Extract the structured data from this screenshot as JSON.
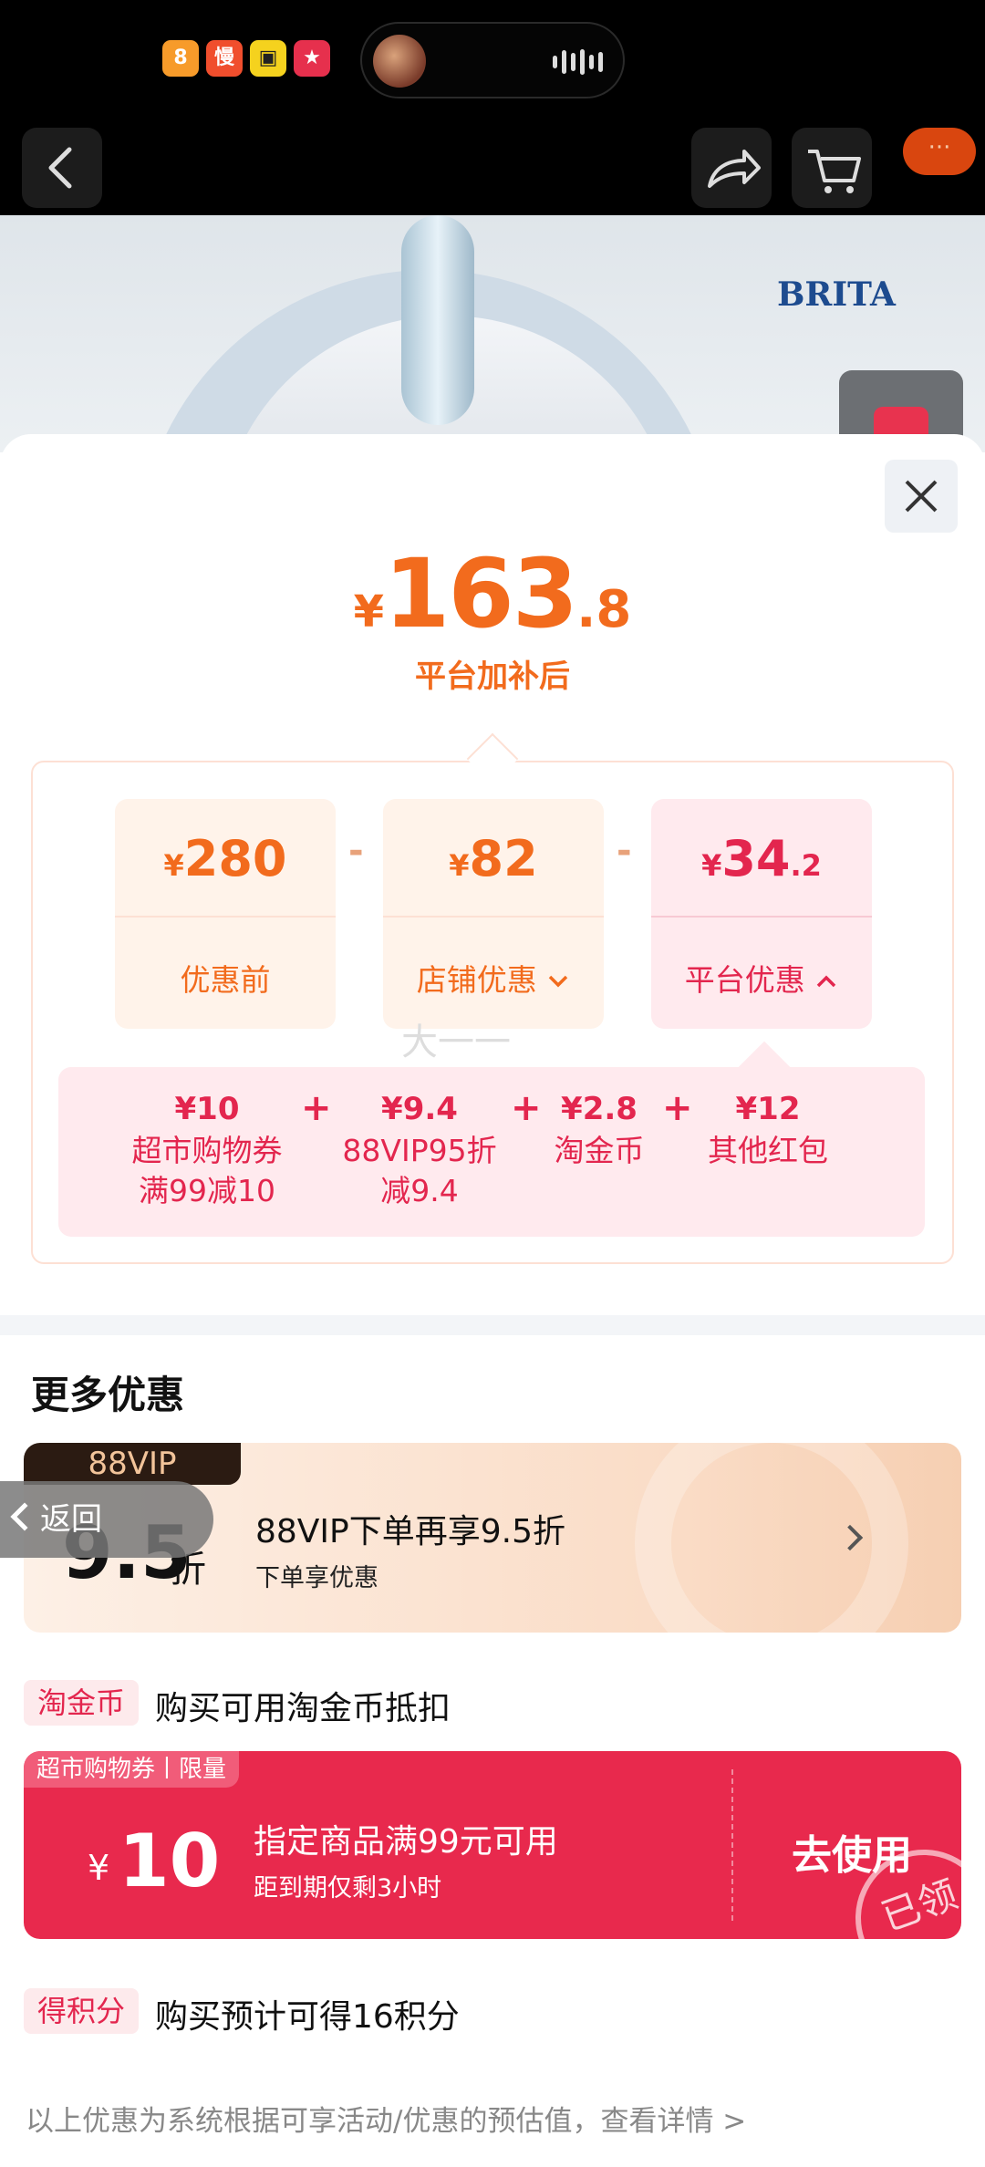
{
  "status_bar": {
    "app_icons": [
      {
        "label": "8",
        "color": "#f79b2a"
      },
      {
        "label": "慢",
        "color": "#f04e2d"
      },
      {
        "label": "▣",
        "color": "#f5d21e"
      },
      {
        "label": "★",
        "color": "#e6304d"
      }
    ]
  },
  "nav": {
    "back_icon": "chevron-left-icon",
    "share_icon": "share-icon",
    "cart_icon": "cart-icon",
    "more_badge": "···"
  },
  "product": {
    "brand": "BRITA"
  },
  "sheet": {
    "close_icon": "close-icon",
    "price": {
      "yen": "¥",
      "integer": "163",
      "decimal": ".8"
    },
    "price_caption": "平台加补后",
    "cards": [
      {
        "yen": "¥",
        "value": "280",
        "label": "优惠前"
      },
      {
        "yen": "¥",
        "value": "82",
        "label": "店铺优惠"
      },
      {
        "yen": "¥",
        "value": "34",
        "decimal": ".2",
        "label": "平台优惠"
      }
    ],
    "operators": [
      "-",
      "-"
    ],
    "platform_items": [
      {
        "value": "¥10",
        "desc_line1": "超市购物券",
        "desc_line2": "满99减10"
      },
      {
        "value": "¥9.4",
        "desc_line1": "88VIP95折",
        "desc_line2": "减9.4"
      },
      {
        "value": "¥2.8",
        "desc_line1": "淘金币",
        "desc_line2": ""
      },
      {
        "value": "¥12",
        "desc_line1": "其他红包",
        "desc_line2": ""
      }
    ],
    "plus": [
      "+",
      "+",
      "+"
    ],
    "ghost_text": "大一一"
  },
  "more": {
    "title": "更多优惠",
    "vip": {
      "tag": "88VIP",
      "discount": "9.5",
      "discount_unit": "折",
      "title": "88VIP下单再享9.5折",
      "subtitle": "下单享优惠"
    },
    "back_label": "返回",
    "coin_row": {
      "tag": "淘金币",
      "text": "购买可用淘金币抵扣"
    },
    "coupon": {
      "tag": "超市购物券丨限量",
      "yen": "¥",
      "amount": "10",
      "title": "指定商品满99元可用",
      "subtitle": "距到期仅剩3小时",
      "action": "去使用",
      "stamp": "已领"
    },
    "points_row": {
      "tag": "得积分",
      "text": "购买预计可得16积分"
    }
  },
  "footer": "以上优惠为系统根据可享活动/优惠的预估值，查看详情 >",
  "colors": {
    "accent_orange": "#f26b1d",
    "accent_red": "#e3264e",
    "coupon_red": "#e8294d"
  }
}
